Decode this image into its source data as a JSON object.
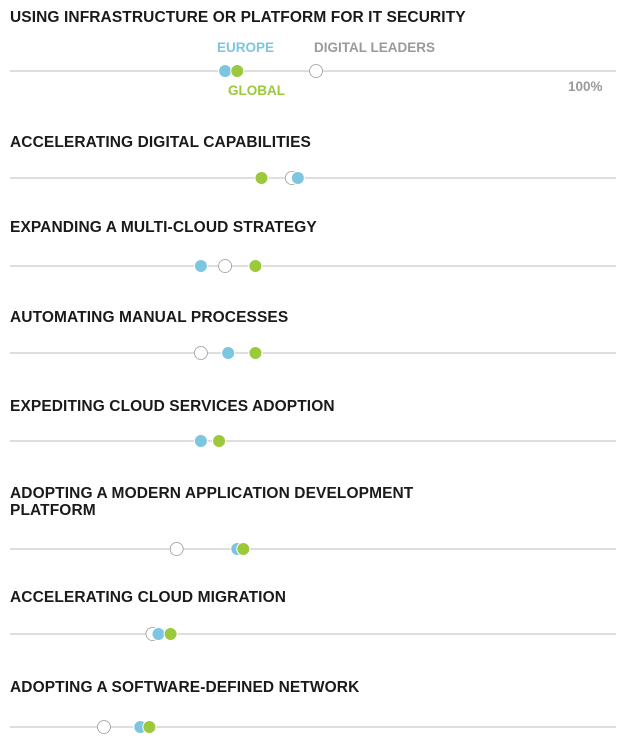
{
  "colors": {
    "europe": "#7cc6e0",
    "global": "#9cc83b",
    "digital_leaders": "#ffffff",
    "track": "#bdbdbd",
    "title": "#1a1a1a",
    "muted": "#9a9a9a"
  },
  "legend": {
    "europe": "EUROPE",
    "global": "GLOBAL",
    "digital_leaders": "DIGITAL LEADERS"
  },
  "axis": {
    "max_label": "100%"
  },
  "chart_data": {
    "type": "scatter",
    "xlim": [
      0,
      100
    ],
    "series": [
      {
        "name": "EUROPE",
        "color": "#7cc6e0",
        "values": [
          35.5,
          47.5,
          31.5,
          36,
          31.5,
          37.5,
          24.5,
          21.5
        ]
      },
      {
        "name": "GLOBAL",
        "color": "#9cc83b",
        "values": [
          37.5,
          41.5,
          40.5,
          40.5,
          34.5,
          38.5,
          26.5,
          23
        ]
      },
      {
        "name": "DIGITAL LEADERS",
        "color": "#ffffff",
        "values": [
          50.5,
          46.5,
          35.5,
          31.5,
          31.5,
          27.5,
          23.5,
          15.5
        ]
      }
    ],
    "categories": [
      "USING INFRASTRUCTURE OR PLATFORM FOR IT SECURITY",
      "ACCELERATING DIGITAL CAPABILITIES",
      "EXPANDING A MULTI-CLOUD STRATEGY",
      "AUTOMATING MANUAL PROCESSES",
      "EXPEDITING CLOUD SERVICES ADOPTION",
      "ADOPTING A MODERN APPLICATION DEVELOPMENT PLATFORM",
      "ACCELERATING CLOUD MIGRATION",
      "ADOPTING A SOFTWARE-DEFINED NETWORK"
    ]
  }
}
